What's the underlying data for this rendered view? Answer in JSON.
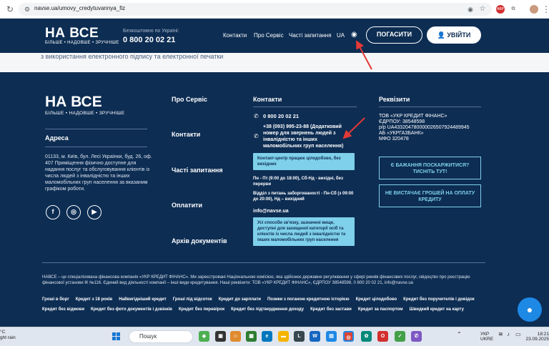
{
  "browser": {
    "url": "navse.ua/umovy_credytuvannya_fiz",
    "ext_abp": "ABP",
    "ext_puzzle": "⧉"
  },
  "header": {
    "logo": "НА ВСЕ",
    "logo_sub": "БІЛЬШЕ • НАДОВШЕ • ЗРУЧНІШЕ",
    "phone_label": "Безкоштовно по Україні:",
    "phone": "0 800 20 02 21",
    "nav": [
      "Контакти",
      "Про Сервіс",
      "Часті запитання",
      "UA"
    ],
    "pay_button": "ПОГАСИТИ",
    "login_button": "УВІЙТИ"
  },
  "content": {
    "text": "з використання електронного підпису та електронної печатки"
  },
  "footer": {
    "logo": "НА ВСЕ",
    "logo_sub": "БІЛЬШЕ • НАДОВШЕ • ЗРУЧНІШЕ",
    "address_title": "Адреса",
    "address": "01133, м. Київ, бул. Лесі Українки, буд. 26, оф. 407 Приміщення фізично доступне для надання послуг та обслуговування клієнтів із числа людей з інвалідністю та інших маломобільних груп населення за вказаним графіком роботи.",
    "social": [
      "f",
      "◎",
      "▶"
    ],
    "menu": [
      "Про Сервіс",
      "Контакти",
      "Часті запитання",
      "Оплатити",
      "Архів документів"
    ],
    "contacts_title": "Контакти",
    "phone": "0 800 20 02 21",
    "phone2": "+38 (093) 995-23-88 (Додатковий номер для звернень людей з інвалідністю та інших маломобільних груп населення)",
    "info_box1": "Контакт-центр працює цілодобово, без вихідних",
    "hours1": "Пн - Пт (9:00 до 18:00), Сб-Нд - вихідні, без перерви",
    "hours2": "Відділ з питань заборгованості - Пн-Сб (з 09:00 до 20:00), Нд – вихідний",
    "email": "info@navse.ua",
    "info_box2": "Усі способи зв'язку, зазначені вище, доступні для захищеної категорії осіб та клієнтів із числа людей з інвалідністю та інших маломобільних груп населення",
    "req_title": "Реквізити",
    "requisites": [
      "ТОВ «УКР КРЕДИТ ФІНАНС»",
      "ЄДРПОУ: 38548598",
      "р/р UA433204780000026507924489945",
      "АБ «УКРГАЗБАНК»",
      "МФО 320478"
    ],
    "btn_postpone": "Є БАЖАННЯ ПОСКАРЖИТИСЯ? ТИСНІТЬ ТУТ!",
    "btn_nomoney": "НЕ ВИСТАЧАЄ ГРОШЕЙ НА ОПЛАТУ КРЕДИТУ",
    "legal": "НАВСЕ – це спеціалізована фінансова компанія «УКР КРЕДИТ ФІНАНС». Ми зареєстровані Національною комісією, яка здійснює державне регулювання у сфері ринків фінансових послуг, свідоцтво про реєстрацію фінансової установи ІК №116. Єдиний вид діяльності компанії – інші види кредитування. Наші реквізити: ТОВ «УКР КРЕДИТ ФІНАНС», ЄДРПОУ 38548598, 0 800 20 02 21, info@navse.ua",
    "links_row1": [
      "Гроші в борг",
      "Кредит з 18 років",
      "Найвигідніший кредит",
      "Гроші під відсоток",
      "Кредит до зарплати",
      "Позики з поганою кредитною історією",
      "Кредит цілодобово",
      "Кредит без поручителів і довідок"
    ],
    "links_row2": [
      "Кредит без відмови",
      "Кредит без фото документів і дзвінків",
      "Кредит без перевірок",
      "Кредит без підтвердження доходу",
      "Кредит без застави",
      "Кредит за паспортом",
      "Швидкий кредит на карту"
    ]
  },
  "taskbar": {
    "weather_temp": "°C",
    "weather_desc": "ght rain",
    "search": "Пошук",
    "lang1": "УКР",
    "lang2": "UKRE",
    "time": "18:21",
    "date": "23.09.2025"
  },
  "colors": {
    "navy": "#0d2d53",
    "cyan": "#7fd0ea",
    "arrow": "#e53935"
  }
}
